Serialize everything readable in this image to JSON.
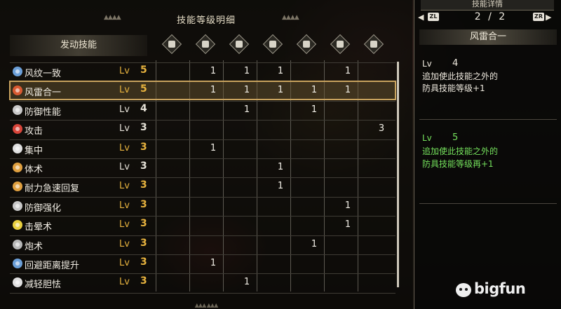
{
  "title": "技能等级明细",
  "header_label": "发动技能",
  "decor_glyph": "▲▲▲▲",
  "bottom_glyph": "▲▲▲ ▲▲▲",
  "equip_icons": [
    "weapon-icon",
    "helmet-icon",
    "chest-icon",
    "arms-icon",
    "waist-icon",
    "legs-icon",
    "talisman-icon"
  ],
  "lv_label": "Lv",
  "skills": [
    {
      "name": "风纹一致",
      "level": "5",
      "gem": "#6b9fd8",
      "lv_color": "gold",
      "cells": [
        "",
        "1",
        "1",
        "1",
        "",
        "1",
        ""
      ]
    },
    {
      "name": "风雷合一",
      "level": "5",
      "gem": "#d85a32",
      "lv_color": "gold",
      "cells": [
        "",
        "1",
        "1",
        "1",
        "1",
        "1",
        ""
      ],
      "selected": true
    },
    {
      "name": "防御性能",
      "level": "4",
      "gem": "#c8c8c8",
      "lv_color": "white",
      "cells": [
        "",
        "",
        "1",
        "",
        "1",
        "",
        ""
      ]
    },
    {
      "name": "攻击",
      "level": "3",
      "gem": "#d8453a",
      "lv_color": "white",
      "cells": [
        "",
        "",
        "",
        "",
        "",
        "",
        "3"
      ]
    },
    {
      "name": "集中",
      "level": "3",
      "gem": "#e0e0e0",
      "lv_color": "gold",
      "cells": [
        "",
        "1",
        "",
        "",
        "",
        "",
        ""
      ]
    },
    {
      "name": "体术",
      "level": "3",
      "gem": "#e0a040",
      "lv_color": "white",
      "cells": [
        "",
        "",
        "",
        "1",
        "",
        "",
        ""
      ]
    },
    {
      "name": "耐力急速回复",
      "level": "3",
      "gem": "#e0a040",
      "lv_color": "gold",
      "cells": [
        "",
        "",
        "",
        "1",
        "",
        "",
        ""
      ]
    },
    {
      "name": "防御强化",
      "level": "3",
      "gem": "#c8c8c8",
      "lv_color": "gold",
      "cells": [
        "",
        "",
        "",
        "",
        "",
        "1",
        ""
      ]
    },
    {
      "name": "击晕术",
      "level": "3",
      "gem": "#e8d040",
      "lv_color": "gold",
      "cells": [
        "",
        "",
        "",
        "",
        "",
        "1",
        ""
      ]
    },
    {
      "name": "炮术",
      "level": "3",
      "gem": "#b8b8b8",
      "lv_color": "gold",
      "cells": [
        "",
        "",
        "",
        "",
        "1",
        "",
        ""
      ]
    },
    {
      "name": "回避距离提升",
      "level": "3",
      "gem": "#6b9fd8",
      "lv_color": "gold",
      "cells": [
        "",
        "1",
        "",
        "",
        "",
        "",
        ""
      ]
    },
    {
      "name": "减轻胆怯",
      "level": "3",
      "gem": "#e0e0e0",
      "lv_color": "gold",
      "cells": [
        "",
        "",
        "1",
        "",
        "",
        "",
        ""
      ]
    }
  ],
  "side": {
    "top_label": "技能详情",
    "left_key": "ZL",
    "right_key": "ZR",
    "page": "2 / 2",
    "skill_name": "风雷合一",
    "levels": [
      {
        "lv": "Lv",
        "num": "4",
        "desc_line1": "追加使此技能之外的",
        "desc_line2": "防具技能等级+1",
        "color": "white"
      },
      {
        "lv": "Lv",
        "num": "5",
        "desc_line1": "追加使此技能之外的",
        "desc_line2": "防具技能等级再+1",
        "color": "green"
      }
    ]
  },
  "watermark": "bigfun"
}
